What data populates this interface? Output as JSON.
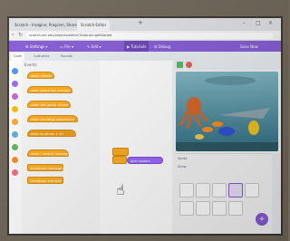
{
  "browser": {
    "tabs": [
      {
        "label": "Scratch - Imagine, Program, Share"
      },
      {
        "label": "Scratch Editor"
      }
    ],
    "url": "scratch.mit.edu/projects/editor/?tutorial=getStarted"
  },
  "menubar": {
    "settings_label": "Settings",
    "file_label": "File",
    "edit_label": "Edit",
    "tutorials_label": "Tutorials",
    "debug_label": "Debug",
    "save_label": "Save Now"
  },
  "code_tabs": [
    "Code",
    "Costumes",
    "Sounds"
  ],
  "palette": {
    "title": "Events",
    "blocks": [
      "when clicked",
      "when space key pressed",
      "when this sprite clicked",
      "when backdrop switches to",
      "when loudness > 10",
      "when I receive message1",
      "broadcast message1",
      "broadcast and wait"
    ]
  },
  "workspace": {
    "reporter_label": "pick random"
  },
  "sprite_pane": {
    "sprite_label": "Sprite",
    "show_label": "Show"
  },
  "colors": {
    "menubar": "#855cd6",
    "events": "#ffab19",
    "operators": "#9966ff",
    "stage_water": "#3f7f91"
  }
}
